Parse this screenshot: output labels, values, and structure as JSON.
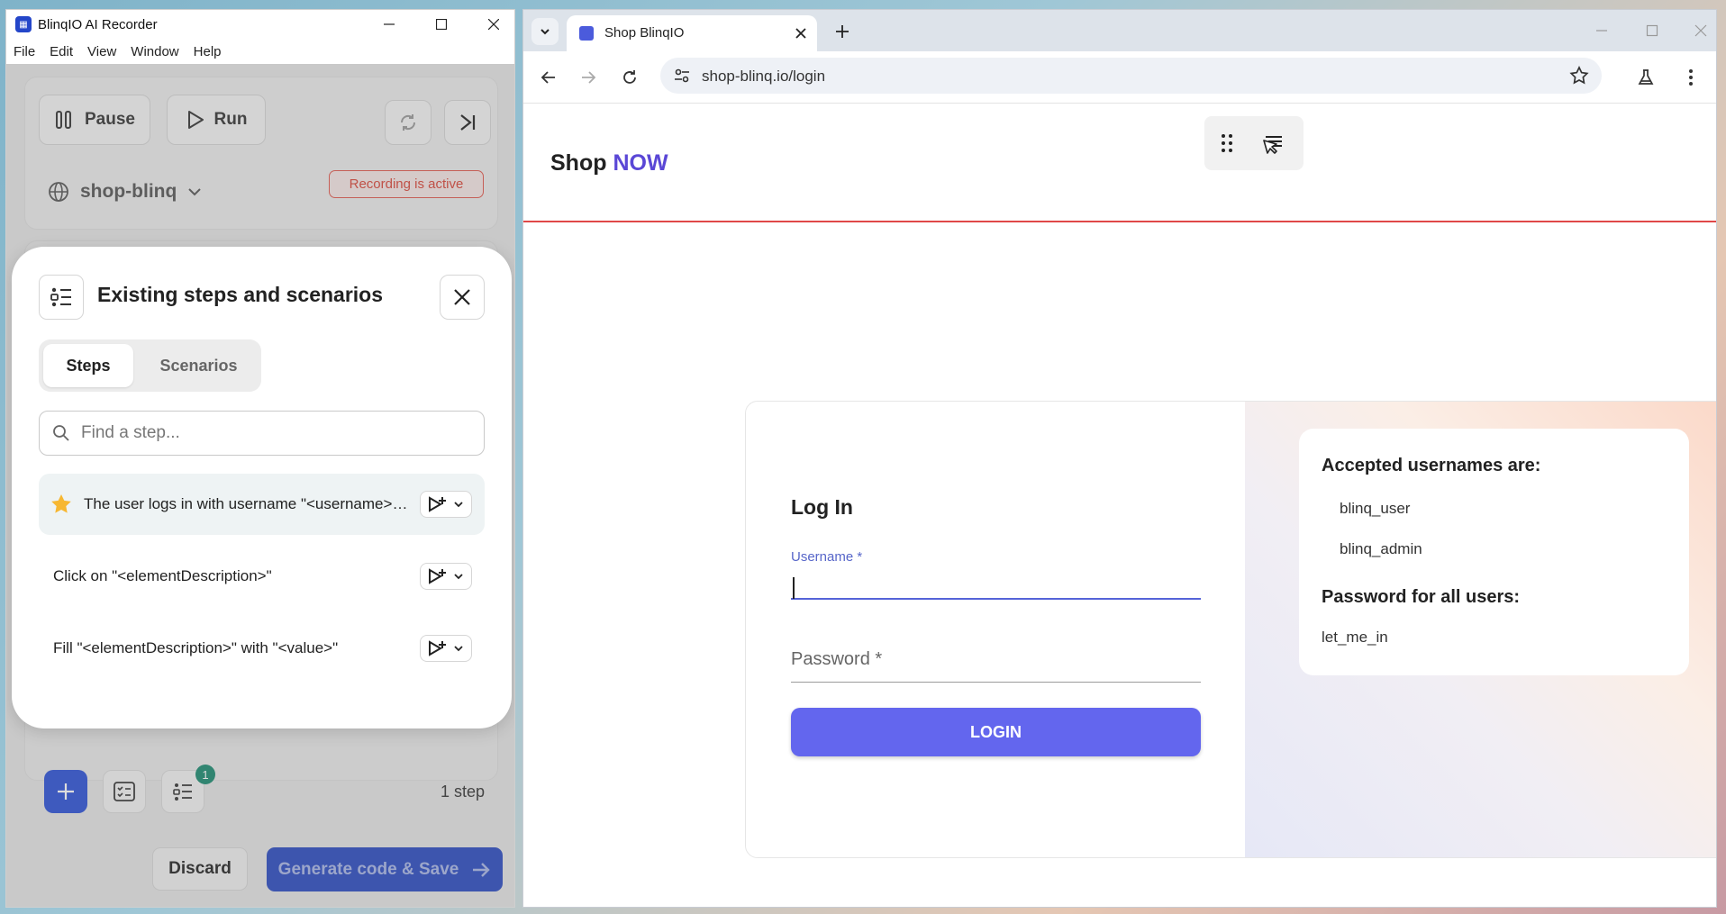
{
  "recorder": {
    "title": "BlinqIO AI Recorder",
    "menu": [
      "File",
      "Edit",
      "View",
      "Window",
      "Help"
    ],
    "pause_label": "Pause",
    "run_label": "Run",
    "project": "shop-blinq",
    "recording_status": "Recording is active",
    "step_badge": "1",
    "step_count": "1 step",
    "discard_label": "Discard",
    "generate_label": "Generate code & Save"
  },
  "dialog": {
    "title": "Existing steps and scenarios",
    "tabs": {
      "steps": "Steps",
      "scenarios": "Scenarios"
    },
    "active_tab": "Steps",
    "search_placeholder": "Find a step...",
    "steps": [
      {
        "text": "The user logs in with username \"<username>\" and password \"<password>\"",
        "favorite": true
      },
      {
        "text": "Click on \"<elementDescription>\"",
        "favorite": false
      },
      {
        "text": "Fill \"<elementDescription>\" with \"<value>\"",
        "favorite": false
      }
    ]
  },
  "browser": {
    "tab_title": "Shop BlinqIO",
    "url": "shop-blinq.io/login"
  },
  "shop": {
    "logo_prefix": "Shop",
    "logo_accent": "NOW",
    "login_title": "Log In",
    "username_label": "Username *",
    "username_value": "",
    "password_placeholder": "Password *",
    "login_button": "LOGIN",
    "accepted_heading": "Accepted usernames are:",
    "usernames": [
      "blinq_user",
      "blinq_admin"
    ],
    "password_heading": "Password for all users:",
    "password_value": "let_me_in"
  },
  "colors": {
    "accent": "#5a47d6",
    "login_button": "#6366ee",
    "recording": "#d84437",
    "primary_dark": "#2a4ac0",
    "badge": "#1a8a6f"
  }
}
